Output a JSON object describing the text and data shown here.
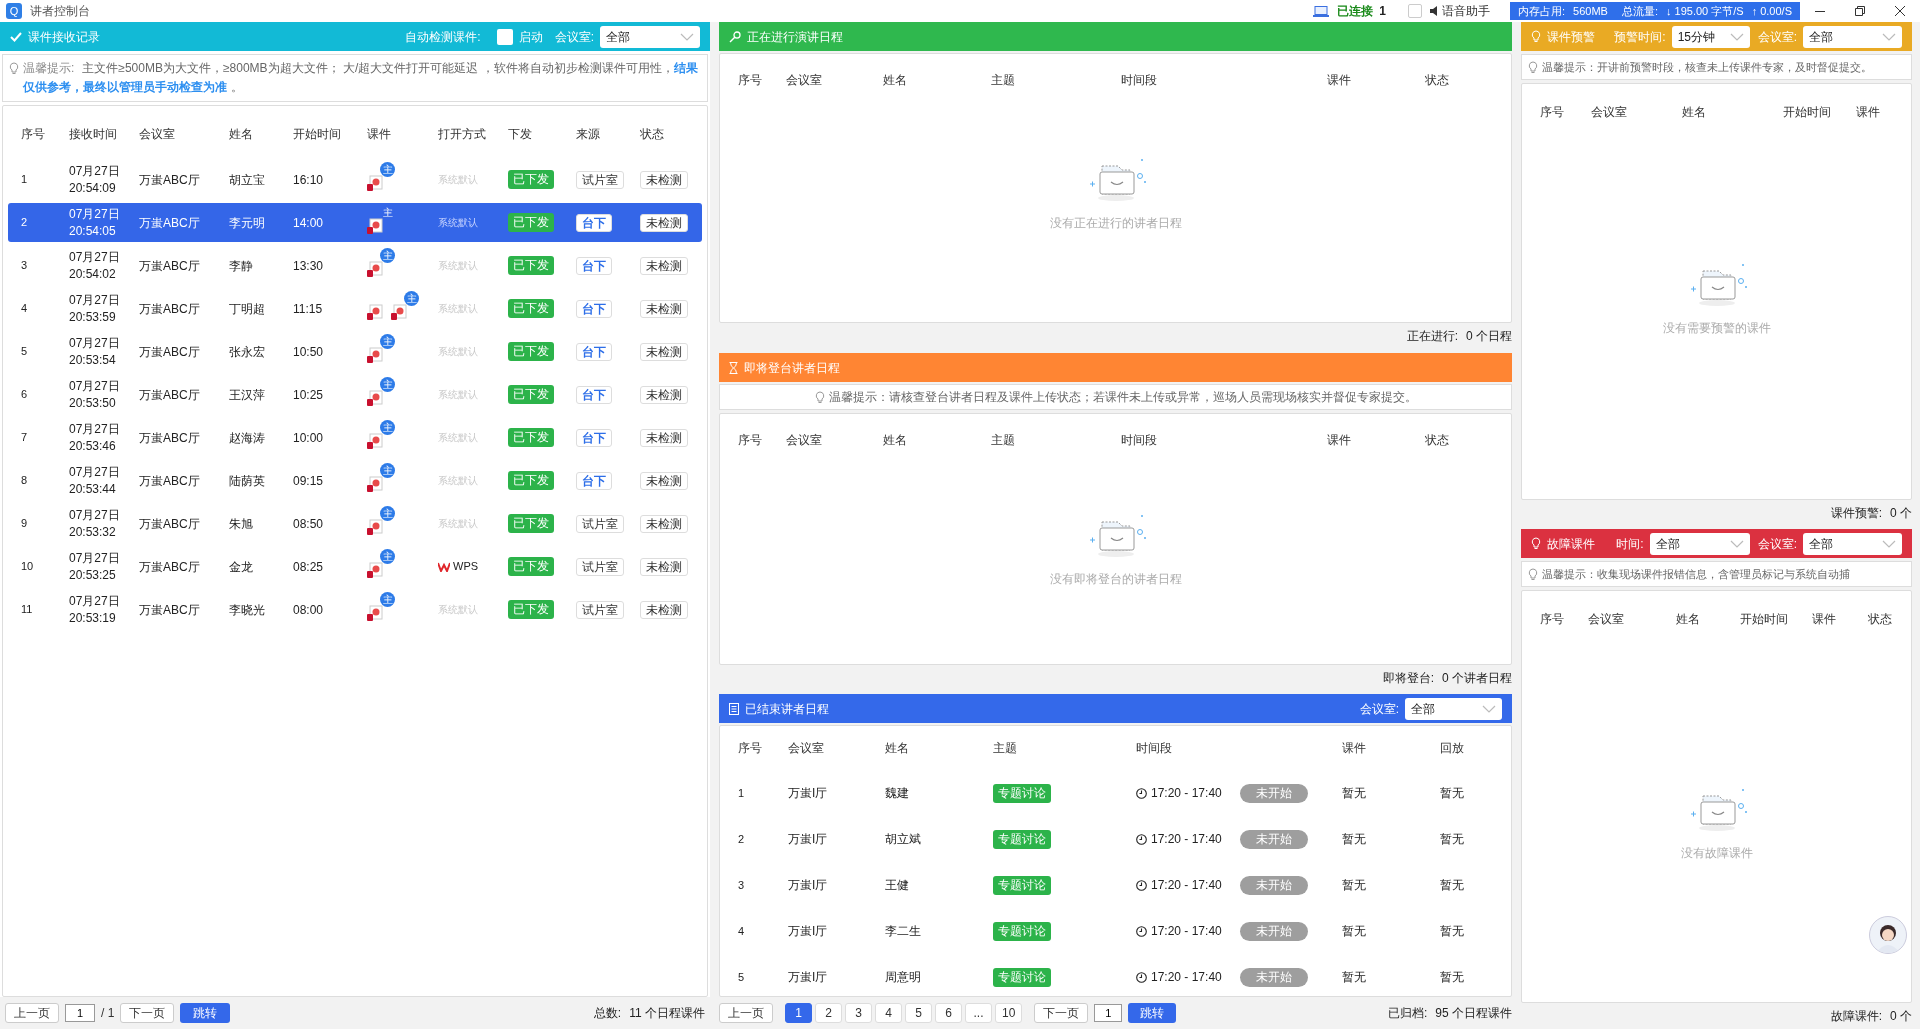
{
  "app": {
    "logo": "Q",
    "title": "讲者控制台"
  },
  "status": {
    "connection": "已连接",
    "connection_count": "1",
    "voice": {
      "label": "语音助手",
      "checked": false
    },
    "memory_label": "内存占用:",
    "memory": "560MB",
    "traffic_label": "总流量:",
    "down": "↓ 195.00 字节/S",
    "up": "↑ 0.00/S"
  },
  "received": {
    "title": "课件接收记录",
    "auto_check": {
      "label": "自动检测课件:",
      "checked": false,
      "option": "启动"
    },
    "room_filter": {
      "label": "会议室:",
      "value": "全部"
    },
    "tip": {
      "label": "温馨提示:",
      "text": "主文件≥500MB为大文件，≥800MB为超大文件；  大/超大文件打开可能延迟 ，软件将自动初步检测课件可用性，",
      "highlight": "结果仅供参考，最终以管理员手动检查为准",
      "end": "。"
    },
    "columns": [
      "序号",
      "接收时间",
      "会议室",
      "姓名",
      "开始时间",
      "课件",
      "打开方式",
      "下发",
      "来源",
      "状态"
    ],
    "rows": [
      {
        "no": "1",
        "date": "07月27日",
        "time": "20:54:09",
        "room": "万蚩ABC厅",
        "name": "胡立宝",
        "start": "16:10",
        "files": [
          {
            "kind": "slides",
            "badge": "主"
          }
        ],
        "open": {
          "kind": "default",
          "text": "系统默认"
        },
        "dispatch": "已下发",
        "source": {
          "kind": "room",
          "text": "试片室"
        },
        "state": "未检测",
        "selected": false
      },
      {
        "no": "2",
        "date": "07月27日",
        "time": "20:54:05",
        "room": "万蚩ABC厅",
        "name": "李元明",
        "start": "14:00",
        "files": [
          {
            "kind": "slides",
            "badge": "主"
          }
        ],
        "open": {
          "kind": "default",
          "text": "系统默认"
        },
        "dispatch": "已下发",
        "source": {
          "kind": "stage",
          "text": "台下"
        },
        "state": "未检测",
        "selected": true
      },
      {
        "no": "3",
        "date": "07月27日",
        "time": "20:54:02",
        "room": "万蚩ABC厅",
        "name": "李静",
        "start": "13:30",
        "files": [
          {
            "kind": "slides",
            "badge": "主"
          }
        ],
        "open": {
          "kind": "default",
          "text": "系统默认"
        },
        "dispatch": "已下发",
        "source": {
          "kind": "stage",
          "text": "台下"
        },
        "state": "未检测",
        "selected": false
      },
      {
        "no": "4",
        "date": "07月27日",
        "time": "20:53:59",
        "room": "万蚩ABC厅",
        "name": "丁明超",
        "start": "11:15",
        "files": [
          {
            "kind": "slides"
          },
          {
            "kind": "slides",
            "badge": "主"
          }
        ],
        "open": {
          "kind": "default",
          "text": "系统默认"
        },
        "dispatch": "已下发",
        "source": {
          "kind": "stage",
          "text": "台下"
        },
        "state": "未检测",
        "selected": false
      },
      {
        "no": "5",
        "date": "07月27日",
        "time": "20:53:54",
        "room": "万蚩ABC厅",
        "name": "张永宏",
        "start": "10:50",
        "files": [
          {
            "kind": "slides",
            "badge": "主"
          }
        ],
        "open": {
          "kind": "default",
          "text": "系统默认"
        },
        "dispatch": "已下发",
        "source": {
          "kind": "stage",
          "text": "台下"
        },
        "state": "未检测",
        "selected": false
      },
      {
        "no": "6",
        "date": "07月27日",
        "time": "20:53:50",
        "room": "万蚩ABC厅",
        "name": "王汉萍",
        "start": "10:25",
        "files": [
          {
            "kind": "slides",
            "badge": "主"
          }
        ],
        "open": {
          "kind": "default",
          "text": "系统默认"
        },
        "dispatch": "已下发",
        "source": {
          "kind": "stage",
          "text": "台下"
        },
        "state": "未检测",
        "selected": false
      },
      {
        "no": "7",
        "date": "07月27日",
        "time": "20:53:46",
        "room": "万蚩ABC厅",
        "name": "赵海涛",
        "start": "10:00",
        "files": [
          {
            "kind": "slides",
            "badge": "主"
          }
        ],
        "open": {
          "kind": "default",
          "text": "系统默认"
        },
        "dispatch": "已下发",
        "source": {
          "kind": "stage",
          "text": "台下"
        },
        "state": "未检测",
        "selected": false
      },
      {
        "no": "8",
        "date": "07月27日",
        "time": "20:53:44",
        "room": "万蚩ABC厅",
        "name": "陆荫英",
        "start": "09:15",
        "files": [
          {
            "kind": "slides",
            "badge": "主"
          }
        ],
        "open": {
          "kind": "default",
          "text": "系统默认"
        },
        "dispatch": "已下发",
        "source": {
          "kind": "stage",
          "text": "台下"
        },
        "state": "未检测",
        "selected": false
      },
      {
        "no": "9",
        "date": "07月27日",
        "time": "20:53:32",
        "room": "万蚩ABC厅",
        "name": "朱旭",
        "start": "08:50",
        "files": [
          {
            "kind": "slides",
            "badge": "主"
          }
        ],
        "open": {
          "kind": "default",
          "text": "系统默认"
        },
        "dispatch": "已下发",
        "source": {
          "kind": "room",
          "text": "试片室"
        },
        "state": "未检测",
        "selected": false
      },
      {
        "no": "10",
        "date": "07月27日",
        "time": "20:53:25",
        "room": "万蚩ABC厅",
        "name": "金龙",
        "start": "08:25",
        "files": [
          {
            "kind": "slides",
            "badge": "主"
          }
        ],
        "open": {
          "kind": "wps",
          "text": "WPS"
        },
        "dispatch": "已下发",
        "source": {
          "kind": "room",
          "text": "试片室"
        },
        "state": "未检测",
        "selected": false
      },
      {
        "no": "11",
        "date": "07月27日",
        "time": "20:53:19",
        "room": "万蚩ABC厅",
        "name": "李晓光",
        "start": "08:00",
        "files": [
          {
            "kind": "slides",
            "badge": "主"
          }
        ],
        "open": {
          "kind": "default",
          "text": "系统默认"
        },
        "dispatch": "已下发",
        "source": {
          "kind": "room",
          "text": "试片室"
        },
        "state": "未检测",
        "selected": false
      }
    ],
    "pager": {
      "prev": "上一页",
      "page": "1",
      "of": "/ 1",
      "next": "下一页",
      "go": "跳转",
      "total_label": "总数:",
      "total": "11 个日程课件"
    }
  },
  "ongoing": {
    "title": "正在进行演讲日程",
    "columns": [
      "序号",
      "会议室",
      "姓名",
      "主题",
      "时间段",
      "课件",
      "状态"
    ],
    "empty": "没有正在进行的讲者日程",
    "footer_label": "正在进行:",
    "footer": "0 个日程"
  },
  "upcoming": {
    "title": "即将登台讲者日程",
    "tip": "温馨提示：请核查登台讲者日程及课件上传状态；若课件未上传或异常，巡场人员需现场核实并督促专家提交。",
    "columns": [
      "序号",
      "会议室",
      "姓名",
      "主题",
      "时间段",
      "课件",
      "状态"
    ],
    "empty": "没有即将登台的讲者日程",
    "footer_label": "即将登台:",
    "footer": "0 个讲者日程"
  },
  "finished": {
    "title": "已结束讲者日程",
    "room_filter": {
      "label": "会议室:",
      "value": "全部"
    },
    "columns": [
      "序号",
      "会议室",
      "姓名",
      "主题",
      "时间段",
      "课件",
      "回放"
    ],
    "rows": [
      {
        "no": "1",
        "room": "万蚩I厅",
        "name": "魏建",
        "topic": "专题讨论",
        "time": "17:20 - 17:40",
        "state": "未开始",
        "courseware": "暂无",
        "playback": "暂无"
      },
      {
        "no": "2",
        "room": "万蚩I厅",
        "name": "胡立斌",
        "topic": "专题讨论",
        "time": "17:20 - 17:40",
        "state": "未开始",
        "courseware": "暂无",
        "playback": "暂无"
      },
      {
        "no": "3",
        "room": "万蚩I厅",
        "name": "王健",
        "topic": "专题讨论",
        "time": "17:20 - 17:40",
        "state": "未开始",
        "courseware": "暂无",
        "playback": "暂无"
      },
      {
        "no": "4",
        "room": "万蚩I厅",
        "name": "李二生",
        "topic": "专题讨论",
        "time": "17:20 - 17:40",
        "state": "未开始",
        "courseware": "暂无",
        "playback": "暂无"
      },
      {
        "no": "5",
        "room": "万蚩I厅",
        "name": "周意明",
        "topic": "专题讨论",
        "time": "17:20 - 17:40",
        "state": "未开始",
        "courseware": "暂无",
        "playback": "暂无"
      }
    ],
    "pager": {
      "prev": "上一页",
      "pages": [
        {
          "label": "1",
          "selected": true
        },
        {
          "label": "2",
          "selected": false
        },
        {
          "label": "3",
          "selected": false
        },
        {
          "label": "4",
          "selected": false
        },
        {
          "label": "5",
          "selected": false
        },
        {
          "label": "6",
          "selected": false
        },
        {
          "label": "...",
          "selected": false
        },
        {
          "label": "10",
          "selected": false
        }
      ],
      "next": "下一页",
      "page": "1",
      "go": "跳转",
      "total_label": "已归档:",
      "total": "95 个日程课件"
    }
  },
  "warning": {
    "title": "课件预警",
    "time_filter": {
      "label": "预警时间:",
      "value": "15分钟"
    },
    "room_filter": {
      "label": "会议室:",
      "value": "全部"
    },
    "tip": "温馨提示：开讲前预警时段，核查未上传课件专家，及时督促提交。",
    "columns": [
      "序号",
      "会议室",
      "姓名",
      "开始时间",
      "课件"
    ],
    "empty": "没有需要预警的课件",
    "footer_label": "课件预警:",
    "footer": "0 个"
  },
  "faults": {
    "title": "故障课件",
    "time_filter": {
      "label": "时间:",
      "value": "全部"
    },
    "room_filter": {
      "label": "会议室:",
      "value": "全部"
    },
    "tip": "温馨提示：收集现场课件报错信息，含管理员标记与系统自动捕",
    "columns": [
      "序号",
      "会议室",
      "姓名",
      "开始时间",
      "课件",
      "状态"
    ],
    "empty": "没有故障课件",
    "footer_label": "故障课件:",
    "footer": "0 个"
  }
}
